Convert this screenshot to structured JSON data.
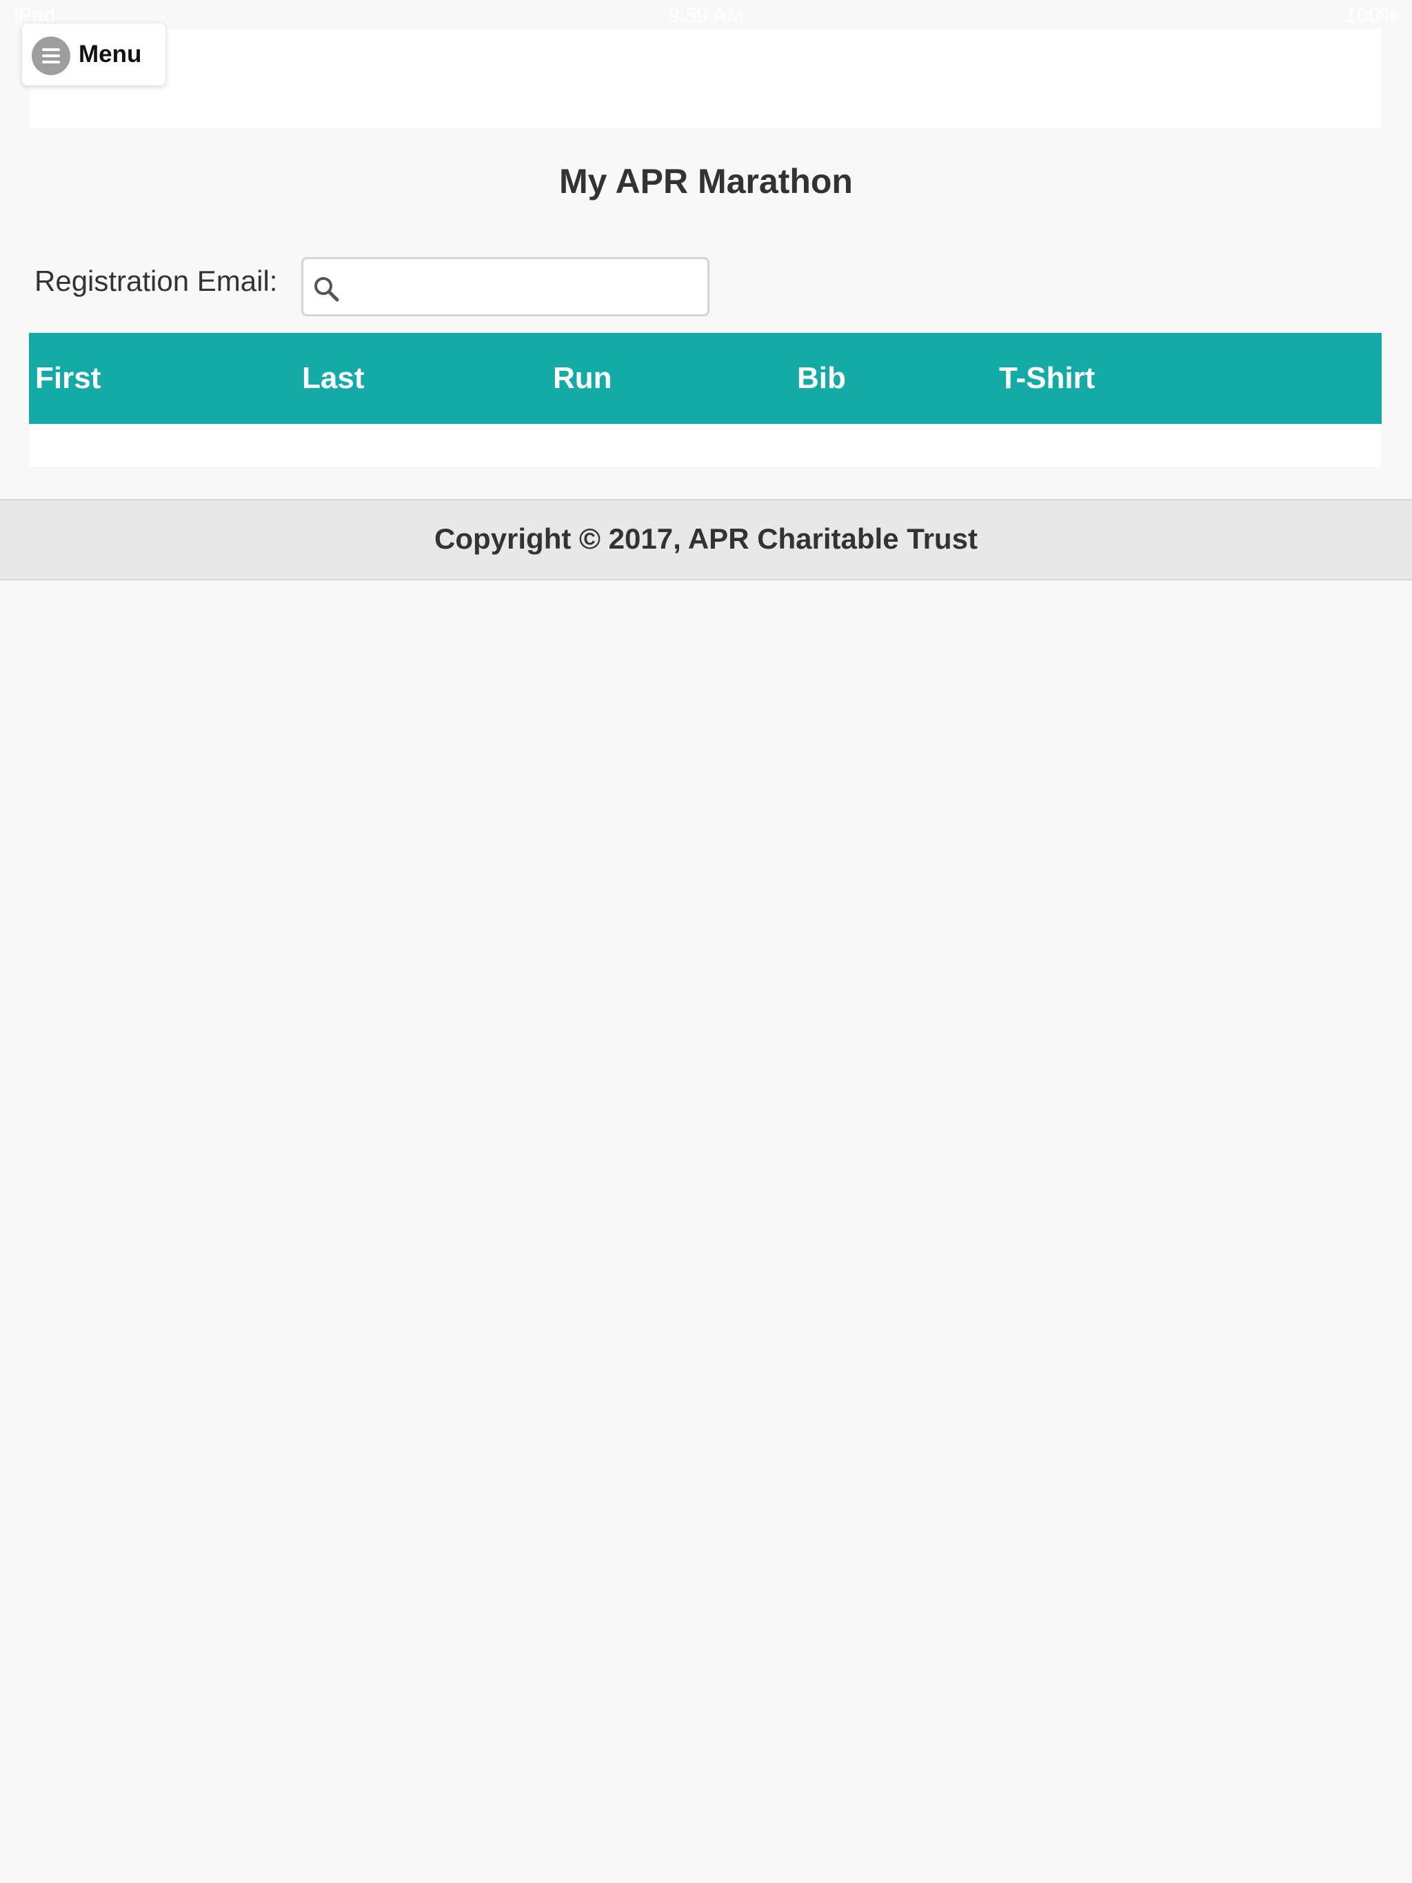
{
  "status_bar": {
    "device": "iPad",
    "time": "9:59 AM",
    "battery": "100%"
  },
  "menu": {
    "label": "Menu",
    "icon": "hamburger-circle-icon"
  },
  "page": {
    "title": "My APR Marathon"
  },
  "registration": {
    "label": "Registration Email:",
    "value": "",
    "placeholder": "",
    "icon": "search-icon"
  },
  "table": {
    "columns": [
      "First",
      "Last",
      "Run",
      "Bib",
      "T-Shirt"
    ],
    "rows": []
  },
  "footer": {
    "copyright": "Copyright © 2017, APR Charitable Trust"
  },
  "colors": {
    "table_header": "#14aba7",
    "background": "#f8f8f8",
    "footer": "#e8e8e8"
  }
}
